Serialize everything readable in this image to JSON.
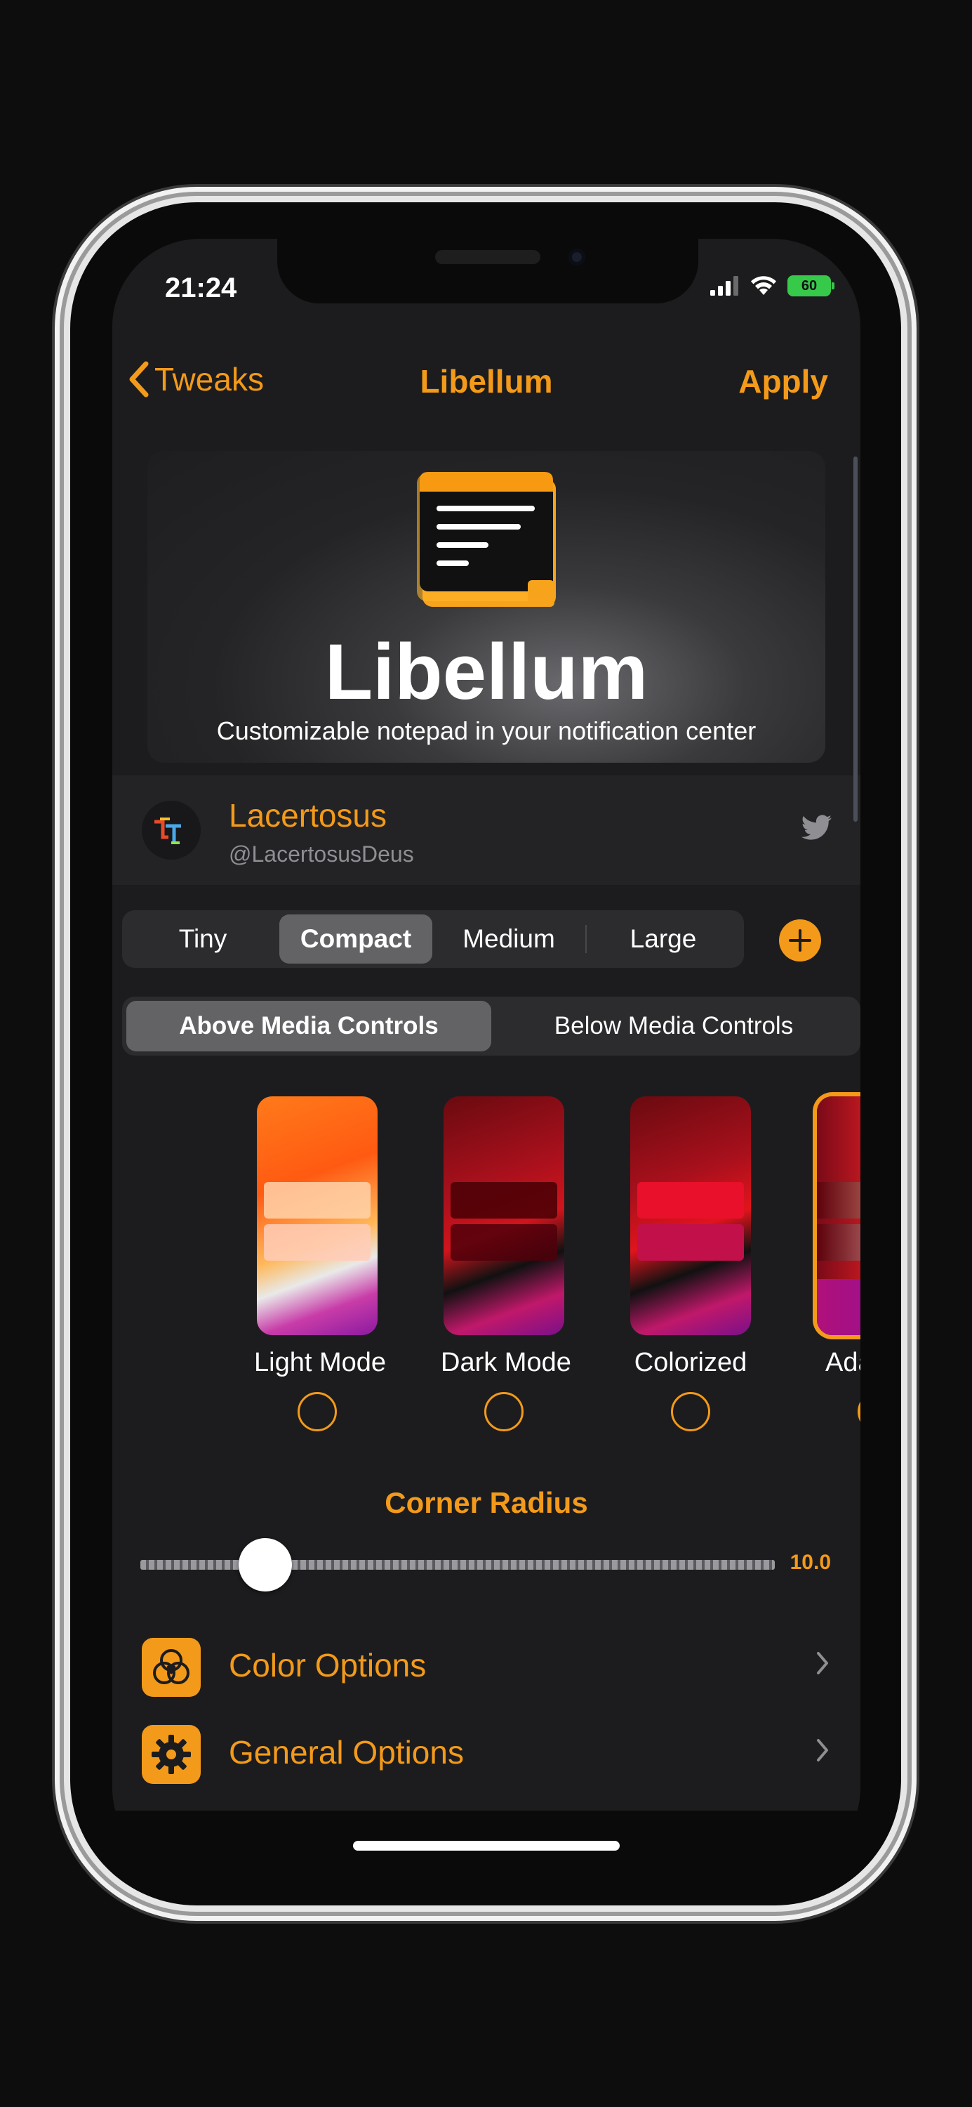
{
  "status_bar": {
    "time": "21:24",
    "battery": "60"
  },
  "nav": {
    "back_label": "Tweaks",
    "title": "Libellum",
    "apply_label": "Apply"
  },
  "header": {
    "title": "Libellum",
    "subtitle": "Customizable notepad in your notification center"
  },
  "author": {
    "name": "Lacertosus",
    "handle": "@LacertosusDeus"
  },
  "size_segments": {
    "items": [
      "Tiny",
      "Compact",
      "Medium",
      "Large"
    ],
    "selected": "Compact"
  },
  "position_segments": {
    "items": [
      "Above Media Controls",
      "Below Media Controls"
    ],
    "selected": "Above Media Controls"
  },
  "modes": [
    {
      "label": "Light Mode",
      "checked": false
    },
    {
      "label": "Dark Mode",
      "checked": false
    },
    {
      "label": "Colorized",
      "checked": false
    },
    {
      "label": "Adaptive",
      "checked": true
    }
  ],
  "slider": {
    "label": "Corner Radius",
    "value": "10.0"
  },
  "options": [
    {
      "label": "Color Options",
      "icon": "color-circles-icon"
    },
    {
      "label": "General Options",
      "icon": "gear-icon"
    }
  ],
  "colors": {
    "accent": "#f39a1a",
    "background": "#1c1c1e",
    "battery": "#37c94a"
  }
}
